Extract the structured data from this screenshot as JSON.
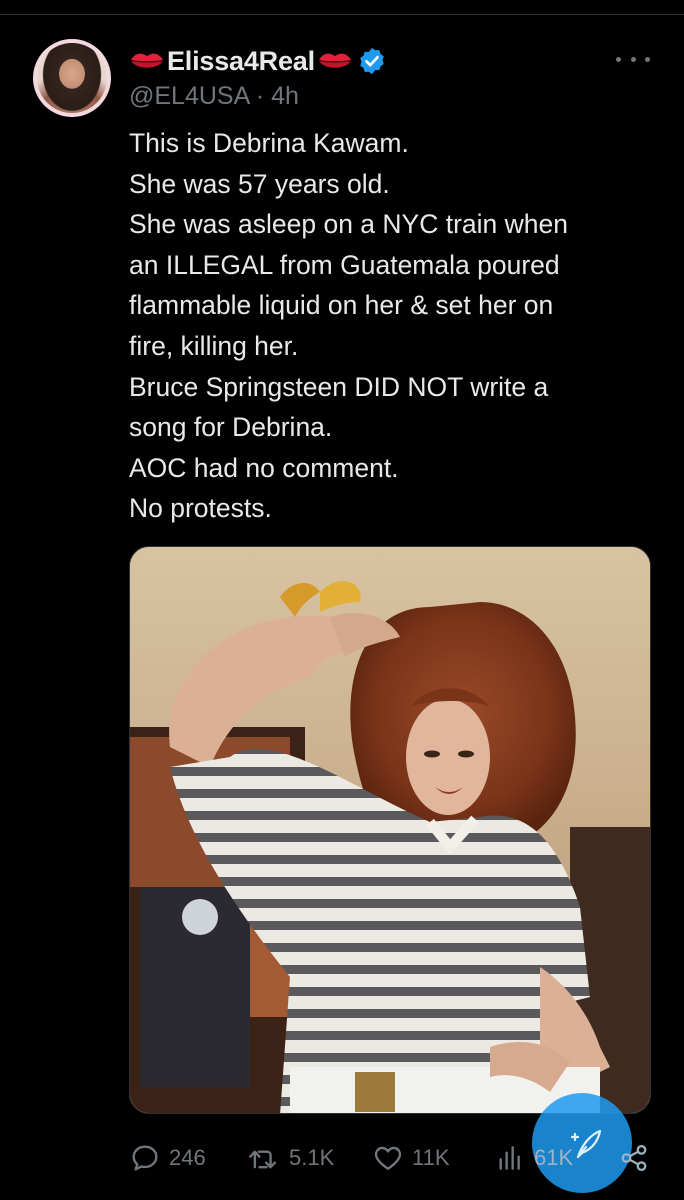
{
  "tweet": {
    "display_name": "Elissa4Real",
    "handle": "@EL4USA",
    "separator": "·",
    "time": "4h",
    "text_lines": [
      "This is Debrina Kawam.",
      "She was 57 years old.",
      "She was asleep on a NYC train when",
      "an ILLEGAL from Guatemala poured",
      "flammable liquid on her & set her on",
      "fire, killing her.",
      "Bruce Springsteen DID NOT write a",
      "song for Debrina.",
      "AOC had no comment.",
      "No protests."
    ]
  },
  "actions": {
    "replies": "246",
    "retweets": "5.1K",
    "likes": "11K",
    "views": "61K"
  },
  "icons": {
    "lips": "lips-icon",
    "verified": "verified-badge-icon",
    "more": "more-options-icon",
    "reply": "reply-icon",
    "retweet": "retweet-icon",
    "like": "heart-icon",
    "views": "views-chart-icon",
    "share": "share-icon",
    "compose": "compose-feather-icon"
  },
  "colors": {
    "background": "#000000",
    "text": "#e7e9ea",
    "muted": "#71767b",
    "accent": "#1d9bf0",
    "lips": "#e0223b"
  }
}
